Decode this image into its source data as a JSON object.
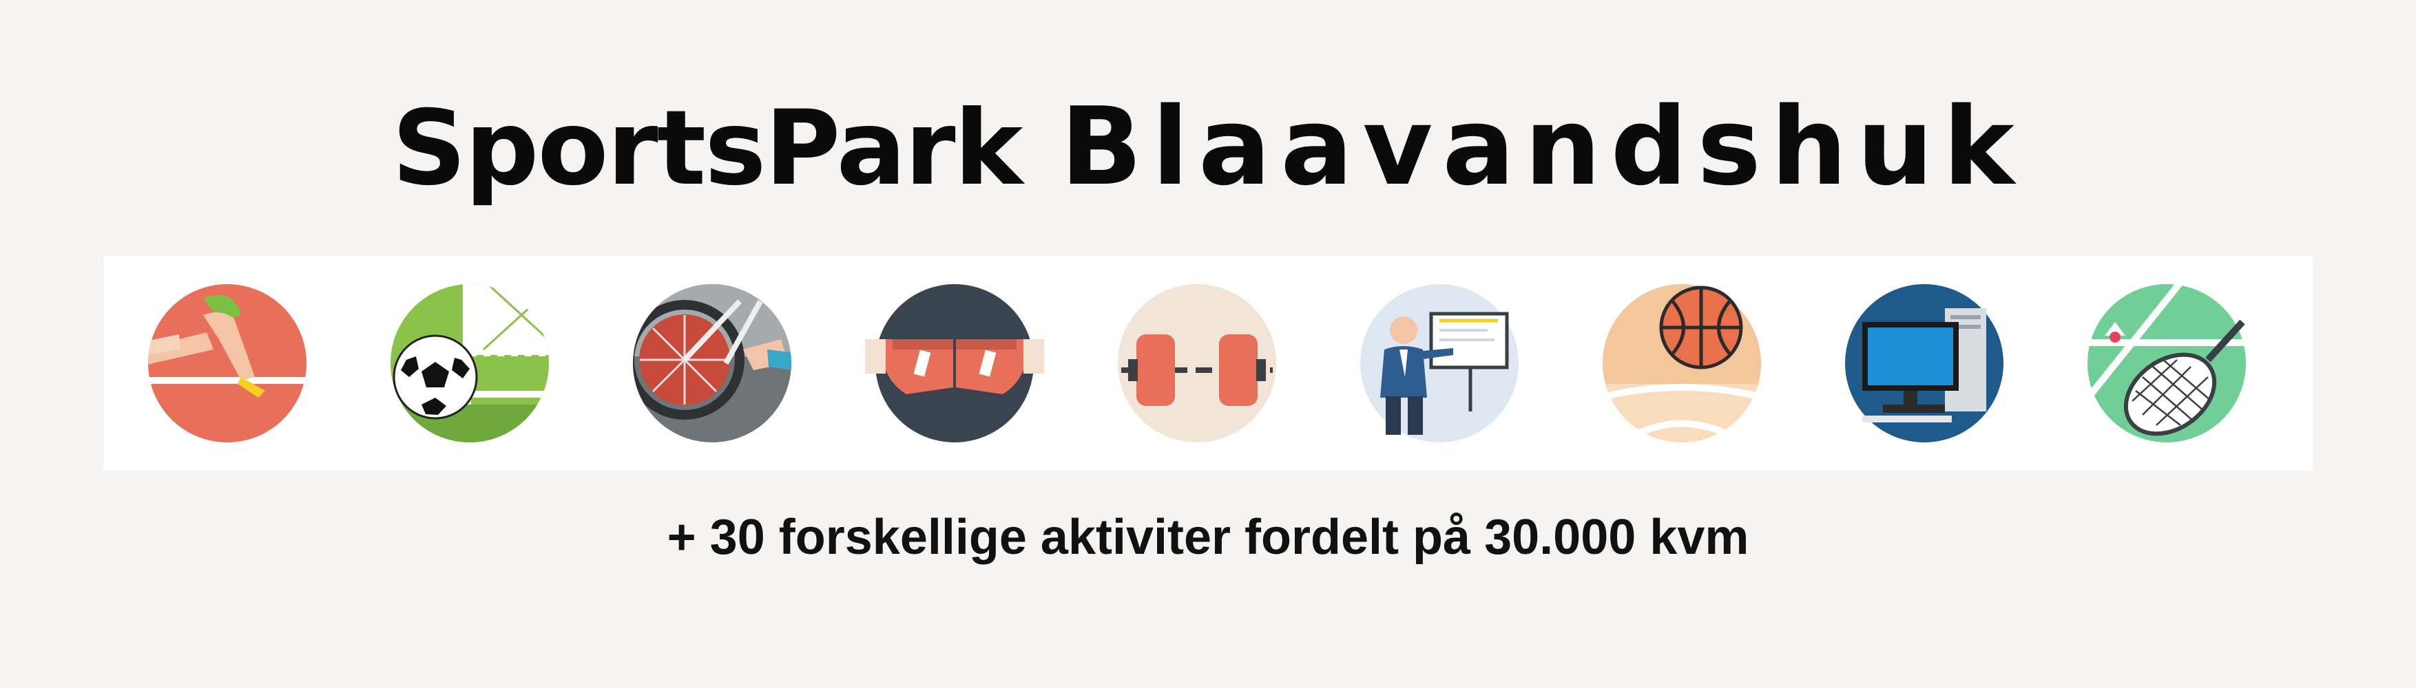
{
  "title": {
    "word1": "SportsPark",
    "word2": "Blaavandshuk"
  },
  "tagline": "+ 30 forskellige aktiviter fordelt på 30.000 kvm",
  "icons": [
    {
      "name": "running-icon",
      "color": "#e8705a"
    },
    {
      "name": "football-icon",
      "color": "#8ac24a"
    },
    {
      "name": "cycling-icon",
      "color": "#6f7478"
    },
    {
      "name": "boxing-gloves-icon",
      "color": "#3a4450"
    },
    {
      "name": "weightlifting-icon",
      "color": "#f3e4d8"
    },
    {
      "name": "presentation-icon",
      "color": "#dfe8f2"
    },
    {
      "name": "basketball-icon",
      "color": "#f4c79a"
    },
    {
      "name": "computer-icon",
      "color": "#1e5a8a"
    },
    {
      "name": "badminton-icon",
      "color": "#6fcf97"
    }
  ]
}
